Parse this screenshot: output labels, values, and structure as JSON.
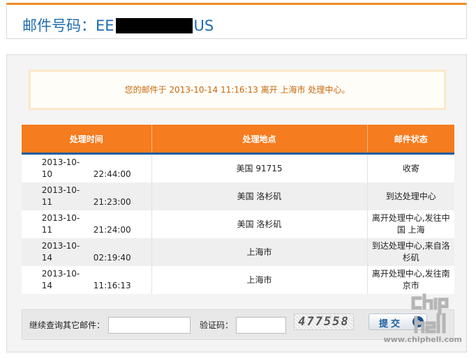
{
  "header": {
    "title_prefix": "邮件号码：EE",
    "title_suffix": "US"
  },
  "notice": {
    "prefix": "您的邮件于",
    "datetime": "2013-10-14 11:16:13",
    "action": "离开",
    "city": "上海市",
    "facility": "处理中心。"
  },
  "table": {
    "headers": [
      "处理时间",
      "处理地点",
      "邮件状态"
    ],
    "rows": [
      {
        "date": "2013-10-10",
        "time": "22:44:00",
        "location": "美国 91715",
        "status": "收寄"
      },
      {
        "date": "2013-10-11",
        "time": "21:23:00",
        "location": "美国 洛杉矶",
        "status": "到达处理中心"
      },
      {
        "date": "2013-10-11",
        "time": "21:24:00",
        "location": "美国 洛杉矶",
        "status": "离开处理中心,发往中国 上海"
      },
      {
        "date": "2013-10-14",
        "time": "02:19:40",
        "location": "上海市",
        "status": "到达处理中心,来自洛杉矶"
      },
      {
        "date": "2013-10-14",
        "time": "11:16:13",
        "location": "上海市",
        "status": "离开处理中心,发往南京市"
      }
    ]
  },
  "query": {
    "other_label": "继续查询其它邮件：",
    "other_value": "",
    "captcha_label": "验证码：",
    "captcha_value": "",
    "captcha_image_text": "477558",
    "submit_label": "提交"
  },
  "watermark": {
    "logo_text": "chip hell",
    "site": "www.chiphell.com"
  },
  "colors": {
    "accent_orange": "#f57c1f",
    "title_blue": "#1f6cb0",
    "notice_text": "#c8670c",
    "header_rule_blue": "#1a5d9e"
  }
}
